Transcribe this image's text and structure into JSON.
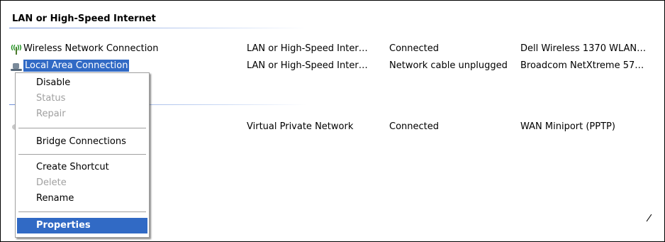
{
  "group": {
    "title": "LAN or High-Speed Internet"
  },
  "connections": [
    {
      "name": "Wireless Network Connection",
      "type": "LAN or High-Speed Inter…",
      "status": "Connected",
      "device": "Dell Wireless 1370 WLAN…",
      "icon": "wireless-network-icon"
    },
    {
      "name": "Local Area Connection",
      "type": "LAN or High-Speed Inter…",
      "status": "Network cable unplugged",
      "device": "Broadcom NetXtreme 57…",
      "icon": "lan-connection-icon",
      "selected": true
    },
    {
      "name": "",
      "type": "Virtual Private Network",
      "status": "Connected",
      "device": "WAN Miniport (PPTP)",
      "icon": "vpn-connection-icon"
    }
  ],
  "context_menu": {
    "items": [
      {
        "label": "Disable",
        "enabled": true
      },
      {
        "label": "Status",
        "enabled": false
      },
      {
        "label": "Repair",
        "enabled": false
      },
      {
        "label": "Bridge Connections",
        "enabled": true
      },
      {
        "label": "Create Shortcut",
        "enabled": true
      },
      {
        "label": "Delete",
        "enabled": false
      },
      {
        "label": "Rename",
        "enabled": true
      },
      {
        "label": "Properties",
        "enabled": true,
        "highlighted": true,
        "bold": true
      }
    ]
  },
  "colors": {
    "selection": "#316ac5",
    "disabled_text": "#a0a0a0",
    "group_line": "#6f8fd8"
  }
}
